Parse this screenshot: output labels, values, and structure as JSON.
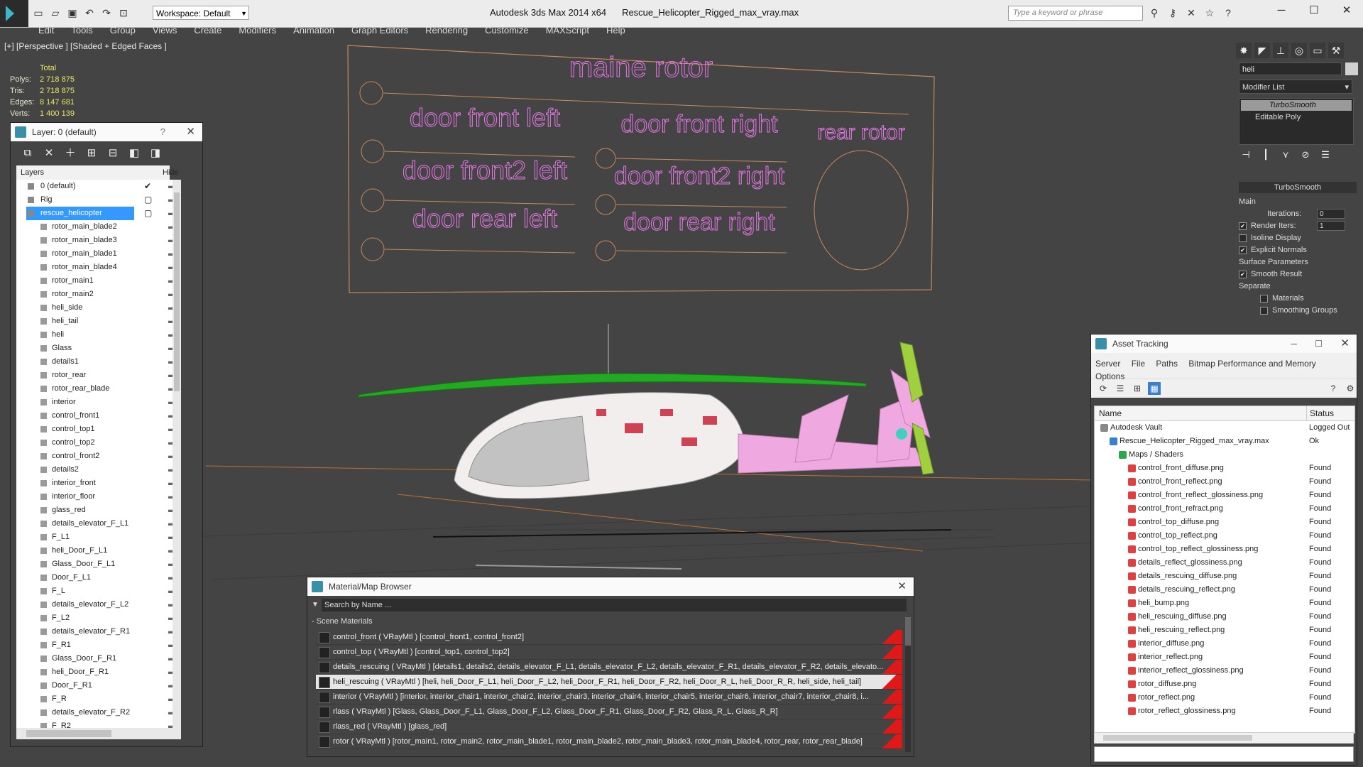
{
  "app": {
    "name": "Autodesk 3ds Max  2014 x64",
    "file": "Rescue_Helicopter_Rigged_max_vray.max",
    "workspace": "Workspace: Default",
    "search_placeholder": "Type a keyword or phrase"
  },
  "menu": [
    "Edit",
    "Tools",
    "Group",
    "Views",
    "Create",
    "Modifiers",
    "Animation",
    "Graph Editors",
    "Rendering",
    "Customize",
    "MAXScript",
    "Help"
  ],
  "viewport": {
    "label": "[+] [Perspective ] [Shaded + Edged Faces ]",
    "stats": {
      "header": "Total",
      "rows": [
        {
          "label": "Polys:",
          "value": "2 718 875"
        },
        {
          "label": "Tris:",
          "value": "2 718 875"
        },
        {
          "label": "Edges:",
          "value": "8 147 681"
        },
        {
          "label": "Verts:",
          "value": "1 400 139"
        }
      ]
    },
    "rig_labels": {
      "main": "maine rotor",
      "door_front_left": "door front left",
      "door_front_right": "door front right",
      "door_front2_left": "door front2 left",
      "door_front2_right": "door front2 right",
      "door_rear_left": "door rear left",
      "door_rear_right": "door rear right",
      "rear_rotor": "rear rotor"
    }
  },
  "layer_panel": {
    "title": "Layer: 0 (default)",
    "help": "?",
    "col_layers": "Layers",
    "col_hide": "Hide",
    "layers": [
      {
        "name": "0 (default)",
        "type": "layer",
        "check": "✔"
      },
      {
        "name": "Rig",
        "type": "layer",
        "check": "▢"
      },
      {
        "name": "rescue_helicopter",
        "type": "layer",
        "check": "▢",
        "selected": true
      },
      {
        "name": "rotor_main_blade2",
        "type": "obj"
      },
      {
        "name": "rotor_main_blade3",
        "type": "obj"
      },
      {
        "name": "rotor_main_blade1",
        "type": "obj"
      },
      {
        "name": "rotor_main_blade4",
        "type": "obj"
      },
      {
        "name": "rotor_main1",
        "type": "obj"
      },
      {
        "name": "rotor_main2",
        "type": "obj"
      },
      {
        "name": "heli_side",
        "type": "obj"
      },
      {
        "name": "heli_tail",
        "type": "obj"
      },
      {
        "name": "heli",
        "type": "obj"
      },
      {
        "name": "Glass",
        "type": "obj"
      },
      {
        "name": "details1",
        "type": "obj"
      },
      {
        "name": "rotor_rear",
        "type": "obj"
      },
      {
        "name": "rotor_rear_blade",
        "type": "obj"
      },
      {
        "name": "interior",
        "type": "obj"
      },
      {
        "name": "control_front1",
        "type": "obj"
      },
      {
        "name": "control_top1",
        "type": "obj"
      },
      {
        "name": "control_top2",
        "type": "obj"
      },
      {
        "name": "control_front2",
        "type": "obj"
      },
      {
        "name": "details2",
        "type": "obj"
      },
      {
        "name": "interior_front",
        "type": "obj"
      },
      {
        "name": "interior_floor",
        "type": "obj"
      },
      {
        "name": "glass_red",
        "type": "obj"
      },
      {
        "name": "details_elevator_F_L1",
        "type": "obj"
      },
      {
        "name": "F_L1",
        "type": "obj"
      },
      {
        "name": "heli_Door_F_L1",
        "type": "obj"
      },
      {
        "name": "Glass_Door_F_L1",
        "type": "obj"
      },
      {
        "name": "Door_F_L1",
        "type": "obj"
      },
      {
        "name": "F_L",
        "type": "obj"
      },
      {
        "name": "details_elevator_F_L2",
        "type": "obj"
      },
      {
        "name": "F_L2",
        "type": "obj"
      },
      {
        "name": "details_elevator_F_R1",
        "type": "obj"
      },
      {
        "name": "F_R1",
        "type": "obj"
      },
      {
        "name": "Glass_Door_F_R1",
        "type": "obj"
      },
      {
        "name": "heli_Door_F_R1",
        "type": "obj"
      },
      {
        "name": "Door_F_R1",
        "type": "obj"
      },
      {
        "name": "F_R",
        "type": "obj"
      },
      {
        "name": "details_elevator_F_R2",
        "type": "obj"
      },
      {
        "name": "F_R2",
        "type": "obj"
      }
    ]
  },
  "command_panel": {
    "object_name": "heli",
    "modifier_list": "Modifier List",
    "stack": [
      "TurboSmooth",
      "Editable Poly"
    ],
    "rollout_title": "TurboSmooth",
    "main": "Main",
    "iterations_label": "Iterations:",
    "iterations": "0",
    "render_iters_label": "Render Iters:",
    "render_iters": "1",
    "isoline": "Isoline Display",
    "explicit_normals": "Explicit Normals",
    "surface_params": "Surface Parameters",
    "smooth_result": "Smooth Result",
    "separate": "Separate",
    "materials": "Materials",
    "smoothing_groups": "Smoothing Groups"
  },
  "asset_tracking": {
    "title": "Asset Tracking",
    "menu": [
      "Server",
      "File",
      "Paths",
      "Bitmap Performance and Memory"
    ],
    "options": "Options",
    "col_name": "Name",
    "col_status": "Status",
    "rows": [
      {
        "name": "Autodesk Vault",
        "status": "Logged Out",
        "level": 0
      },
      {
        "name": "Rescue_Helicopter_Rigged_max_vray.max",
        "status": "Ok",
        "level": 1
      },
      {
        "name": "Maps / Shaders",
        "status": "",
        "level": 2
      },
      {
        "name": "control_front_diffuse.png",
        "status": "Found",
        "level": 3
      },
      {
        "name": "control_front_reflect.png",
        "status": "Found",
        "level": 3
      },
      {
        "name": "control_front_reflect_glossiness.png",
        "status": "Found",
        "level": 3
      },
      {
        "name": "control_front_refract.png",
        "status": "Found",
        "level": 3
      },
      {
        "name": "control_top_diffuse.png",
        "status": "Found",
        "level": 3
      },
      {
        "name": "control_top_reflect.png",
        "status": "Found",
        "level": 3
      },
      {
        "name": "control_top_reflect_glossiness.png",
        "status": "Found",
        "level": 3
      },
      {
        "name": "details_reflect_glossiness.png",
        "status": "Found",
        "level": 3
      },
      {
        "name": "details_rescuing_diffuse.png",
        "status": "Found",
        "level": 3
      },
      {
        "name": "details_rescuing_reflect.png",
        "status": "Found",
        "level": 3
      },
      {
        "name": "heli_bump.png",
        "status": "Found",
        "level": 3
      },
      {
        "name": "heli_rescuing_diffuse.png",
        "status": "Found",
        "level": 3
      },
      {
        "name": "heli_rescuing_reflect.png",
        "status": "Found",
        "level": 3
      },
      {
        "name": "interior_diffuse.png",
        "status": "Found",
        "level": 3
      },
      {
        "name": "interior_reflect.png",
        "status": "Found",
        "level": 3
      },
      {
        "name": "interior_reflect_glossiness.png",
        "status": "Found",
        "level": 3
      },
      {
        "name": "rotor_diffuse.png",
        "status": "Found",
        "level": 3
      },
      {
        "name": "rotor_reflect.png",
        "status": "Found",
        "level": 3
      },
      {
        "name": "rotor_reflect_glossiness.png",
        "status": "Found",
        "level": 3
      }
    ]
  },
  "material_browser": {
    "title": "Material/Map Browser",
    "search_placeholder": "Search by Name ...",
    "group": "- Scene Materials",
    "rows": [
      {
        "text": "control_front  ( VRayMtl ) [control_front1, control_front2]"
      },
      {
        "text": "control_top  ( VRayMtl ) [control_top1, control_top2]"
      },
      {
        "text": "details_rescuing  ( VRayMtl ) [details1, details2, details_elevator_F_L1, details_elevator_F_L2, details_elevator_F_R1, details_elevator_F_R2, details_elevato..."
      },
      {
        "text": "heli_rescuing  ( VRayMtl ) [heli, heli_Door_F_L1, heli_Door_F_L2, heli_Door_F_R1, heli_Door_F_R2, heli_Door_R_L, heli_Door_R_R, heli_side, heli_tail]",
        "selected": true
      },
      {
        "text": "interior  ( VRayMtl ) [interior, interior_chair1, interior_chair2, interior_chair3, interior_chair4, interior_chair5, interior_chair6, interior_chair7, interior_chair8, i..."
      },
      {
        "text": "rlass  ( VRayMtl ) [Glass, Glass_Door_F_L1, Glass_Door_F_L2, Glass_Door_F_R1, Glass_Door_F_R2, Glass_R_L, Glass_R_R]"
      },
      {
        "text": "rlass_red  ( VRayMtl ) [glass_red]"
      },
      {
        "text": "rotor  ( VRayMtl ) [rotor_main1, rotor_main2, rotor_main_blade1, rotor_main_blade2, rotor_main_blade3, rotor_main_blade4, rotor_rear, rotor_rear_blade]"
      }
    ]
  },
  "colors": {
    "accent": "#3399ff",
    "rig_text": "#e878e8",
    "rig_frame": "#c8885a",
    "highlight_red": "#e01818"
  }
}
